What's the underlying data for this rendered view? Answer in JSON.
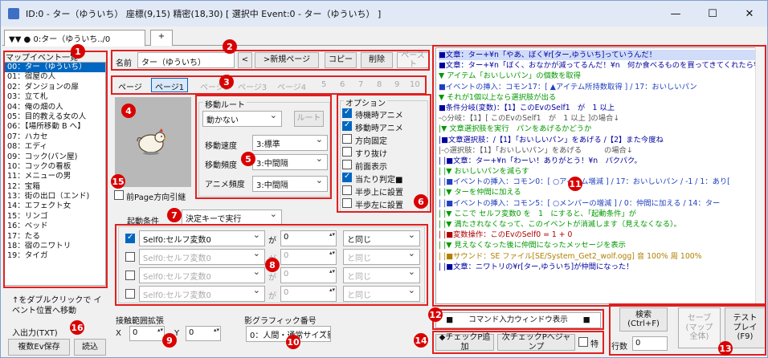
{
  "window": {
    "title": "ID:0 - ター（ゆういち） 座標(9,15) 精密(18,30) [ 選択中 Event:0 - ター（ゆういち） ]",
    "min": "—",
    "max": "☐",
    "close": "✕"
  },
  "tabs": {
    "main": "▼▼ ● 0:ター（ゆういち../0",
    "add": "+"
  },
  "left": {
    "header": "マップイベント一覧",
    "items": [
      "00：ター（ゆういち）",
      "01：宿屋の人",
      "02：ダンジョンの扉",
      "03：立て札",
      "04：俺の畑の人",
      "05：目的教える女の人",
      "06：【場所移動 B へ】",
      "07：ハカセ",
      "08：エディ",
      "09：コック(パン屋)",
      "10：コックの看板",
      "11：メニューの男",
      "12：宝箱",
      "13：街の出口（エンド)",
      "14：エフェクト女",
      "15：リンゴ",
      "16：ベッド",
      "17：たる",
      "18：宿のニワトリ",
      "19：タイガ"
    ],
    "hint": "↑をダブルクリックで イベント位置へ移動",
    "io": "入出力(TXT)",
    "save_multi": "複数Ev保存",
    "load": "読込"
  },
  "name": {
    "label": "名前",
    "value": "ター（ゆういち）",
    "prev": "<",
    "newpage": ">新規ページ",
    "copy": "コピー",
    "delete": "削除",
    "paste": "ペースト"
  },
  "pages": {
    "label": "ページ",
    "tabs": [
      "ページ1",
      "ページ2",
      "ページ3",
      "ページ4",
      "5",
      "6",
      "7",
      "8",
      "9",
      "10"
    ]
  },
  "move": {
    "title": "移動ルート",
    "type": "動かない",
    "route": "ルート",
    "speed_label": "移動速度",
    "speed": "3:標準",
    "freq_label": "移動頻度",
    "freq": "3:中間隔",
    "anim_label": "アニメ頻度",
    "anim": "3:中間隔"
  },
  "options": {
    "title": "オプション",
    "items": [
      {
        "label": "待機時アニメ",
        "checked": true
      },
      {
        "label": "移動時アニメ",
        "checked": true
      },
      {
        "label": "方向固定",
        "checked": false
      },
      {
        "label": "すり抜け",
        "checked": false
      },
      {
        "label": "前面表示",
        "checked": false
      },
      {
        "label": "当たり判定■",
        "checked": true
      },
      {
        "label": "半歩上に設置",
        "checked": false
      },
      {
        "label": "半歩左に設置",
        "checked": false
      }
    ]
  },
  "prev_dir": "前Page方向引継",
  "trigger": {
    "label": "起動条件",
    "value": "決定キーで実行"
  },
  "conditions": [
    {
      "checked": true,
      "var": "Self0:セルフ変数0",
      "ga": "が",
      "val": "0",
      "op": "と同じ"
    },
    {
      "checked": false,
      "var": "Self0:セルフ変数0",
      "ga": "が",
      "val": "0",
      "op": "と同じ"
    },
    {
      "checked": false,
      "var": "Self0:セルフ変数0",
      "ga": "が",
      "val": "0",
      "op": "と同じ"
    },
    {
      "checked": false,
      "var": "Self0:セルフ変数0",
      "ga": "が",
      "val": "0",
      "op": "と同じ"
    }
  ],
  "contact": {
    "label": "接触範囲拡張",
    "x_label": "X",
    "x": "0",
    "y_label": "Y",
    "y": "0"
  },
  "shadow": {
    "label": "影グラフィック番号",
    "value": "0：人間・通常サイズ影"
  },
  "commands": [
    "■文章：ター+¥n「やあ、ぼく¥r[ター,ゆういち]っていうんだ！",
    "■文章：ター+¥n「ぼく、おなかが減ってるんだ！¥n　何か食べるものを買ってきてくれたら¥n",
    "▼ アイテム「おいしいパン」の個数を取得",
    "■イベントの挿入：コモン17：[ ▲アイテム所持数取得 ] / 17：おいしいパン",
    "▼ それが1個以上なら選択肢が出る",
    "■条件分岐(変数)：【1】このEvのSelf1　が　1 以上",
    "-◇分岐：【1】[ このEvのSelf1　が　1 以上 ]の場合↓",
    "|▼ 文章選択肢を実行　パンをあげるかどうか",
    "|■文章選択肢：/【1】「おいしいパン」をあげる /【2】また今度ね",
    "|-◇選択肢：【1】「おいしいパン」をあげる　　　の場合↓",
    "| |■文章：ター+¥n「わーい！ありがとう！¥n　パクパク。",
    "| |▼ おいしいパンを減らす",
    "| |■イベントの挿入：コモン0：[ ○アイテム増減 ] / 17：おいしいパン / -1 / 1：あり[",
    "| |▼ ターを仲間に加える",
    "| |■イベントの挿入：コモン5：[ ○メンバーの増減 ] / 0：仲間に加える / 14：ター",
    "| |▼ ここで セルフ変数0 を　1　にすると、「起動条件」が",
    "| |▼ 満たされなくなって、このイベントが消滅します（見えなくなる）。",
    "| |■変数操作：このEvのSelf0 = 1 + 0",
    "| |▼ 見えなくなった後に仲間になったメッセージを表示",
    "| |■サウンド：SE ファイル[SE/System_Get2_wolf.ogg] 音 100% 周 100%",
    "| |■文章：ニワトリの¥r[ター,ゆういち]が仲間になった！"
  ],
  "cmdbar": {
    "input": "■　　コマンド入力ウィンドウ表示　　■",
    "checkpoint_add": "◆チェックP追加",
    "next_checkpoint": "次チェックPへジャンプ",
    "special": "特"
  },
  "right": {
    "search": "検索\n(Ctrl+F)",
    "save_map": "セーブ\n(マップ\n全体)",
    "test": "テスト\nプレイ\n(F9)",
    "lines_label": "行数",
    "lines": "0"
  },
  "markers": [
    "1",
    "2",
    "3",
    "4",
    "5",
    "6",
    "7",
    "8",
    "9",
    "10",
    "11",
    "12",
    "13",
    "14",
    "15",
    "16"
  ],
  "colors": {
    "accent": "#d90000",
    "selection": "#0067c0",
    "comment": "#009900",
    "command_blue": "#0000a0",
    "disabled": "#a0a0a0"
  }
}
